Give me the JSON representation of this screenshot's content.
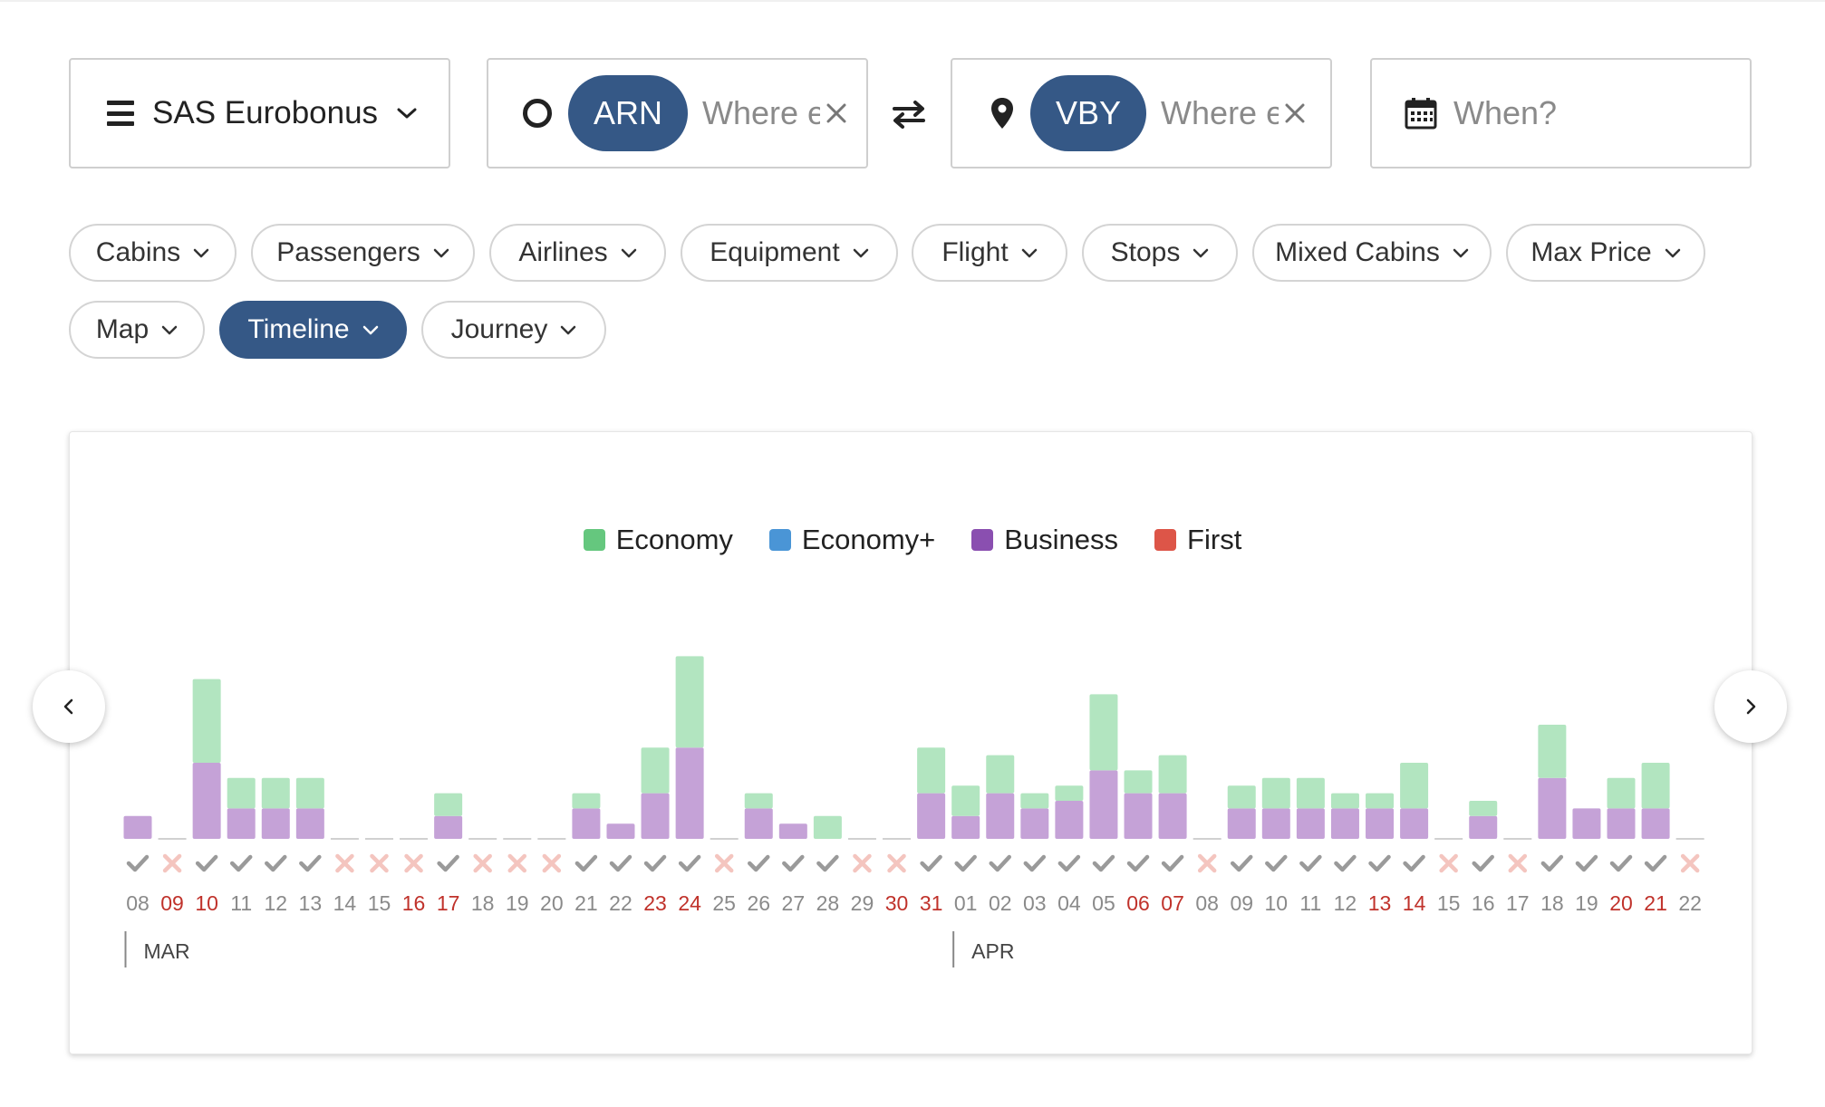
{
  "search": {
    "program": {
      "label": "SAS Eurobonus",
      "icon": "menu-icon"
    },
    "origin": {
      "code": "ARN",
      "placeholder": "Where else?"
    },
    "destination": {
      "code": "VBY",
      "placeholder": "Where else?"
    },
    "when": {
      "placeholder": "When?"
    }
  },
  "filters": [
    {
      "label": "Cabins",
      "active": false
    },
    {
      "label": "Passengers",
      "active": false
    },
    {
      "label": "Airlines",
      "active": false
    },
    {
      "label": "Equipment",
      "active": false
    },
    {
      "label": "Flight",
      "active": false
    },
    {
      "label": "Stops",
      "active": false
    },
    {
      "label": "Mixed Cabins",
      "active": false
    },
    {
      "label": "Max Price",
      "active": false
    },
    {
      "label": "Map",
      "active": false
    },
    {
      "label": "Timeline",
      "active": true
    },
    {
      "label": "Journey",
      "active": false
    }
  ],
  "colors": {
    "accent": "#355886",
    "economy": "#65c77e",
    "economy_plus": "#4a95d6",
    "business": "#8a4fb0",
    "first": "#dd5548",
    "economy_bar": "#b2e5c0",
    "business_bar": "#c5a2d7",
    "weekend": "#c0322b",
    "weekday": "#8a8a8a",
    "check": "#9a9a9a",
    "cross": "#f4c5bf"
  },
  "chart_data": {
    "type": "bar",
    "stacked": true,
    "legend": [
      "Economy",
      "Economy+",
      "Business",
      "First"
    ],
    "legend_placement": "top-center",
    "months": [
      {
        "label": "MAR",
        "start_index": 0
      },
      {
        "label": "APR",
        "start_index": 24
      }
    ],
    "days": [
      "08",
      "09",
      "10",
      "11",
      "12",
      "13",
      "14",
      "15",
      "16",
      "17",
      "18",
      "19",
      "20",
      "21",
      "22",
      "23",
      "24",
      "25",
      "26",
      "27",
      "28",
      "29",
      "30",
      "31",
      "01",
      "02",
      "03",
      "04",
      "05",
      "06",
      "07",
      "08",
      "09",
      "10",
      "11",
      "12",
      "13",
      "14",
      "15",
      "16",
      "17",
      "18",
      "19",
      "20",
      "21",
      "22"
    ],
    "weekend": [
      false,
      true,
      true,
      false,
      false,
      false,
      false,
      false,
      true,
      true,
      false,
      false,
      false,
      false,
      false,
      true,
      true,
      false,
      false,
      false,
      false,
      false,
      true,
      true,
      false,
      false,
      false,
      false,
      false,
      true,
      true,
      false,
      false,
      false,
      false,
      false,
      true,
      true,
      false,
      false,
      false,
      false,
      false,
      true,
      true,
      false
    ],
    "available": [
      true,
      false,
      true,
      true,
      true,
      true,
      false,
      false,
      false,
      true,
      false,
      false,
      false,
      true,
      true,
      true,
      true,
      false,
      true,
      true,
      true,
      false,
      false,
      true,
      true,
      true,
      true,
      true,
      true,
      true,
      true,
      false,
      true,
      true,
      true,
      true,
      true,
      true,
      false,
      true,
      false,
      true,
      true,
      true,
      true,
      false
    ],
    "series": [
      {
        "name": "Business",
        "values": [
          3,
          0,
          10,
          4,
          4,
          4,
          0,
          0,
          0,
          3,
          0,
          0,
          0,
          4,
          2,
          6,
          12,
          0,
          4,
          2,
          0,
          0,
          0,
          6,
          3,
          6,
          4,
          5,
          9,
          6,
          6,
          0,
          4,
          4,
          4,
          4,
          4,
          4,
          0,
          3,
          0,
          8,
          4,
          4,
          4,
          0
        ]
      },
      {
        "name": "Economy",
        "values": [
          0,
          0,
          11,
          4,
          4,
          4,
          0,
          0,
          0,
          3,
          0,
          0,
          0,
          2,
          0,
          6,
          12,
          0,
          2,
          0,
          3,
          0,
          0,
          6,
          4,
          5,
          2,
          2,
          10,
          3,
          5,
          0,
          3,
          4,
          4,
          2,
          2,
          6,
          0,
          2,
          0,
          7,
          0,
          4,
          6,
          0
        ]
      }
    ]
  }
}
